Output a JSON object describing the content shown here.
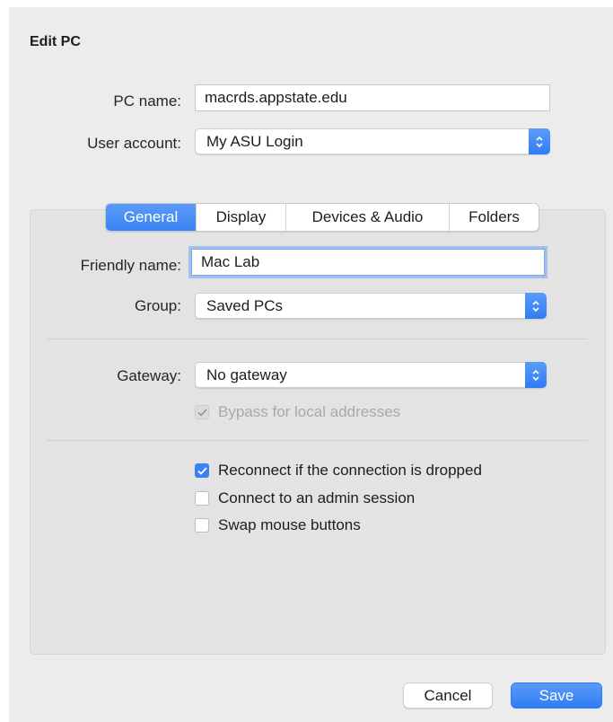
{
  "dialog": {
    "title": "Edit PC"
  },
  "pc_name": {
    "label": "PC name:",
    "value": "macrds.appstate.edu"
  },
  "user_account": {
    "label": "User account:",
    "selected": "My ASU Login"
  },
  "tabs": [
    {
      "label": "General",
      "active": true
    },
    {
      "label": "Display",
      "active": false
    },
    {
      "label": "Devices & Audio",
      "active": false
    },
    {
      "label": "Folders",
      "active": false
    }
  ],
  "general": {
    "friendly_name": {
      "label": "Friendly name:",
      "value": "Mac Lab"
    },
    "group": {
      "label": "Group:",
      "selected": "Saved PCs"
    },
    "gateway": {
      "label": "Gateway:",
      "selected": "No gateway"
    },
    "bypass": {
      "label": "Bypass for local addresses",
      "checked": true,
      "disabled": true
    },
    "options": [
      {
        "label": "Reconnect if the connection is dropped",
        "checked": true
      },
      {
        "label": "Connect to an admin session",
        "checked": false
      },
      {
        "label": "Swap mouse buttons",
        "checked": false
      }
    ]
  },
  "buttons": {
    "cancel": "Cancel",
    "save": "Save"
  },
  "colors": {
    "accent": "#3a83f6",
    "dialog_bg": "#ececec",
    "panel_bg": "#e3e3e3"
  },
  "icons": {
    "popup_stepper": "updown-chevron-icon",
    "checkmark": "checkmark-icon"
  }
}
